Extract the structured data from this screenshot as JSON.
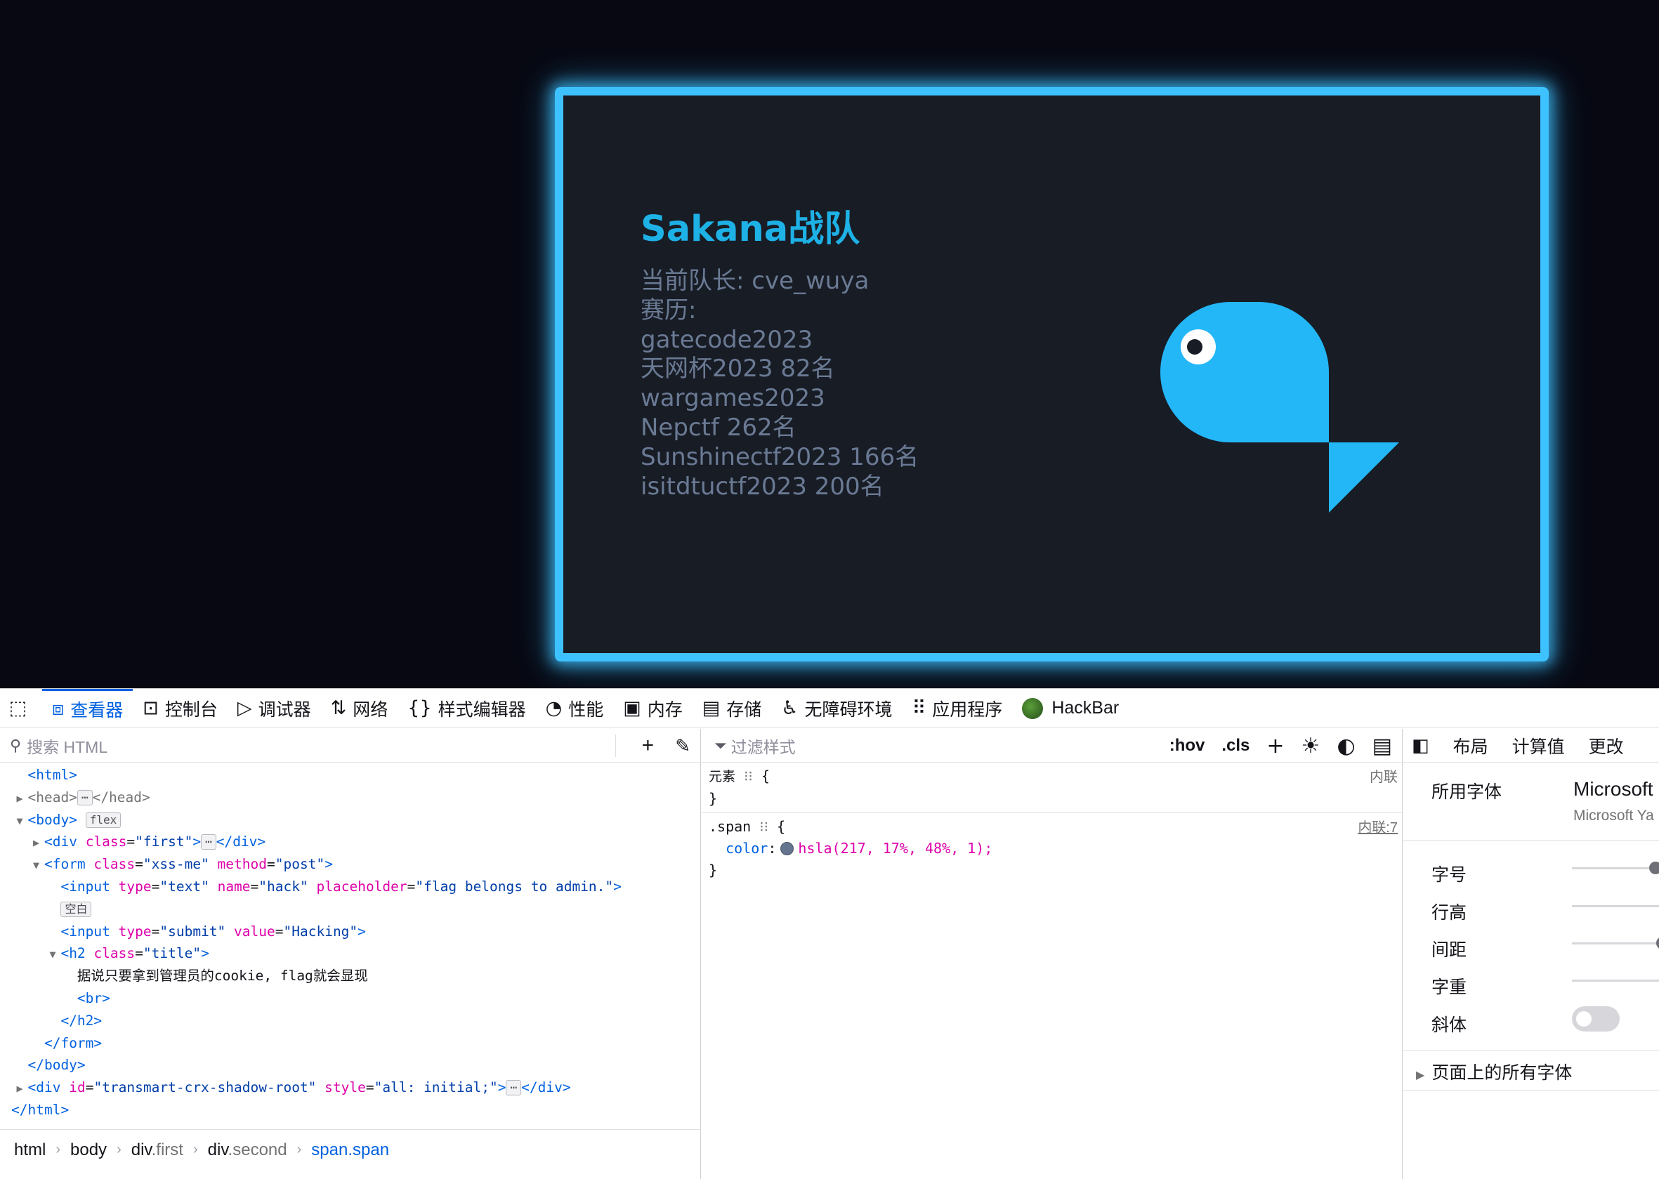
{
  "page": {
    "title": "Sakana战队",
    "info_lines": [
      "当前队长: cve_wuya",
      "赛历:",
      "gatecode2023",
      "天网杯2023 82名",
      "wargames2023",
      "Nepctf 262名",
      "Sunshinectf2023 166名",
      "isitdtuctf2023 200名"
    ],
    "fish_color": "#23b7f8"
  },
  "toolbar": {
    "picker_icon": "element-picker-icon",
    "tabs": [
      {
        "label": "查看器",
        "icon": "⧈",
        "icon_name": "inspector-icon",
        "selected": true
      },
      {
        "label": "控制台",
        "icon": "⊡",
        "icon_name": "console-icon"
      },
      {
        "label": "调试器",
        "icon": "▷",
        "icon_name": "debugger-icon"
      },
      {
        "label": "网络",
        "icon": "⇅",
        "icon_name": "network-icon"
      },
      {
        "label": "样式编辑器",
        "icon": "{}",
        "icon_name": "style-editor-icon"
      },
      {
        "label": "性能",
        "icon": "◔",
        "icon_name": "performance-icon"
      },
      {
        "label": "内存",
        "icon": "▣",
        "icon_name": "memory-icon"
      },
      {
        "label": "存储",
        "icon": "▤",
        "icon_name": "storage-icon"
      },
      {
        "label": "无障碍环境",
        "icon": "♿",
        "icon_name": "accessibility-icon"
      },
      {
        "label": "应用程序",
        "icon": "⠿",
        "icon_name": "application-icon"
      },
      {
        "label": "HackBar",
        "icon": "",
        "icon_name": "hackbar-icon"
      }
    ]
  },
  "inspector": {
    "search_placeholder": "搜索 HTML",
    "tree": {
      "l1_tag": "<html>",
      "l2_open": "<head>",
      "l2_close": "</head>",
      "l3_tag": "<body>",
      "l3_badge": "flex",
      "l4_open": "<div",
      "l4_attr": "class",
      "l4_val": "\"first\"",
      "l4_close": "</div>",
      "l5_open": "<form",
      "l5_a1": "class",
      "l5_v1": "\"xss-me\"",
      "l5_a2": "method",
      "l5_v2": "\"post\"",
      "l6_open": "<input",
      "l6_a1": "type",
      "l6_v1": "\"text\"",
      "l6_a2": "name",
      "l6_v2": "\"hack\"",
      "l6_a3": "placeholder",
      "l6_v3": "\"flag belongs to admin.\"",
      "l7_badge": "空白",
      "l8_open": "<input",
      "l8_a1": "type",
      "l8_v1": "\"submit\"",
      "l8_a2": "value",
      "l8_v2": "\"Hacking\"",
      "l9_open": "<h2",
      "l9_a1": "class",
      "l9_v1": "\"title\"",
      "l10_text": "据说只要拿到管理员的cookie, flag就会显现",
      "l11_tag": "<br>",
      "l12_tag": "</h2>",
      "l13_tag": "</form>",
      "l14_tag": "</body>",
      "l15_open": "<div",
      "l15_a1": "id",
      "l15_v1": "\"transmart-crx-shadow-root\"",
      "l15_a2": "style",
      "l15_v2": "\"all: initial;\"",
      "l15_close": "</div>",
      "l16_tag": "</html>"
    },
    "breadcrumbs": [
      {
        "tag": "html",
        "cls": ""
      },
      {
        "tag": "body",
        "cls": ""
      },
      {
        "tag": "div",
        "cls": ".first"
      },
      {
        "tag": "div",
        "cls": ".second"
      },
      {
        "tag": "span.span",
        "cls": ""
      }
    ]
  },
  "rules": {
    "filter_placeholder": "过滤样式",
    "hov": ":hov",
    "cls": ".cls",
    "element_selector": "元素",
    "element_source": "内联",
    "span_selector": ".span",
    "span_source": "内联:7",
    "prop_name": "color",
    "prop_value": "hsla(217, 17%, 48%, 1);",
    "swatch_color": "#66758f"
  },
  "fonts": {
    "tabs": [
      "布局",
      "计算值",
      "更改"
    ],
    "used_font_label": "所用字体",
    "used_font_name": "Microsoft",
    "used_font_sub": "Microsoft Ya",
    "size_label": "字号",
    "line_height_label": "行高",
    "spacing_label": "间距",
    "weight_label": "字重",
    "italic_label": "斜体",
    "all_fonts_label": "页面上的所有字体"
  }
}
